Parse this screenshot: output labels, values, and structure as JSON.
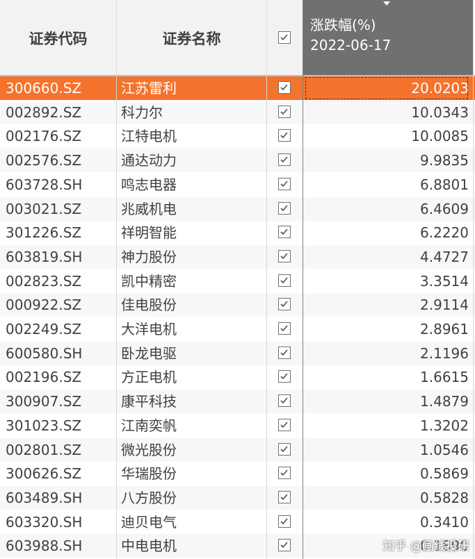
{
  "header": {
    "code": "证券代码",
    "name": "证券名称",
    "change_title": "涨跌幅(%)",
    "change_date": "2022-06-17"
  },
  "rows": [
    {
      "code": "300660.SZ",
      "name": "江苏雷利",
      "value": "20.0203",
      "checked": true
    },
    {
      "code": "002892.SZ",
      "name": "科力尔",
      "value": "10.0343",
      "checked": true
    },
    {
      "code": "002176.SZ",
      "name": "江特电机",
      "value": "10.0085",
      "checked": true
    },
    {
      "code": "002576.SZ",
      "name": "通达动力",
      "value": "9.9835",
      "checked": true
    },
    {
      "code": "603728.SH",
      "name": "鸣志电器",
      "value": "6.8801",
      "checked": true
    },
    {
      "code": "003021.SZ",
      "name": "兆威机电",
      "value": "6.4609",
      "checked": true
    },
    {
      "code": "301226.SZ",
      "name": "祥明智能",
      "value": "6.2220",
      "checked": true
    },
    {
      "code": "603819.SH",
      "name": "神力股份",
      "value": "4.4727",
      "checked": true
    },
    {
      "code": "002823.SZ",
      "name": "凯中精密",
      "value": "3.3514",
      "checked": true
    },
    {
      "code": "000922.SZ",
      "name": "佳电股份",
      "value": "2.9114",
      "checked": true
    },
    {
      "code": "002249.SZ",
      "name": "大洋电机",
      "value": "2.8961",
      "checked": true
    },
    {
      "code": "600580.SH",
      "name": "卧龙电驱",
      "value": "2.1196",
      "checked": true
    },
    {
      "code": "002196.SZ",
      "name": "方正电机",
      "value": "1.6615",
      "checked": true
    },
    {
      "code": "300907.SZ",
      "name": "康平科技",
      "value": "1.4879",
      "checked": true
    },
    {
      "code": "301023.SZ",
      "name": "江南奕帆",
      "value": "1.3202",
      "checked": true
    },
    {
      "code": "002801.SZ",
      "name": "微光股份",
      "value": "1.0546",
      "checked": true
    },
    {
      "code": "300626.SZ",
      "name": "华瑞股份",
      "value": "0.5869",
      "checked": true
    },
    {
      "code": "603489.SH",
      "name": "八方股份",
      "value": "0.5828",
      "checked": true
    },
    {
      "code": "603320.SH",
      "name": "迪贝电气",
      "value": "0.3410",
      "checked": true
    },
    {
      "code": "603988.SH",
      "name": "中电电机",
      "value": "0.1890",
      "checked": true
    }
  ],
  "selected_row": 0,
  "colors": {
    "selected_row": "#f4732d",
    "header_bg": "#f2f2f2",
    "sorted_header_bg": "#707070"
  },
  "watermark": "知乎 @画线投研"
}
